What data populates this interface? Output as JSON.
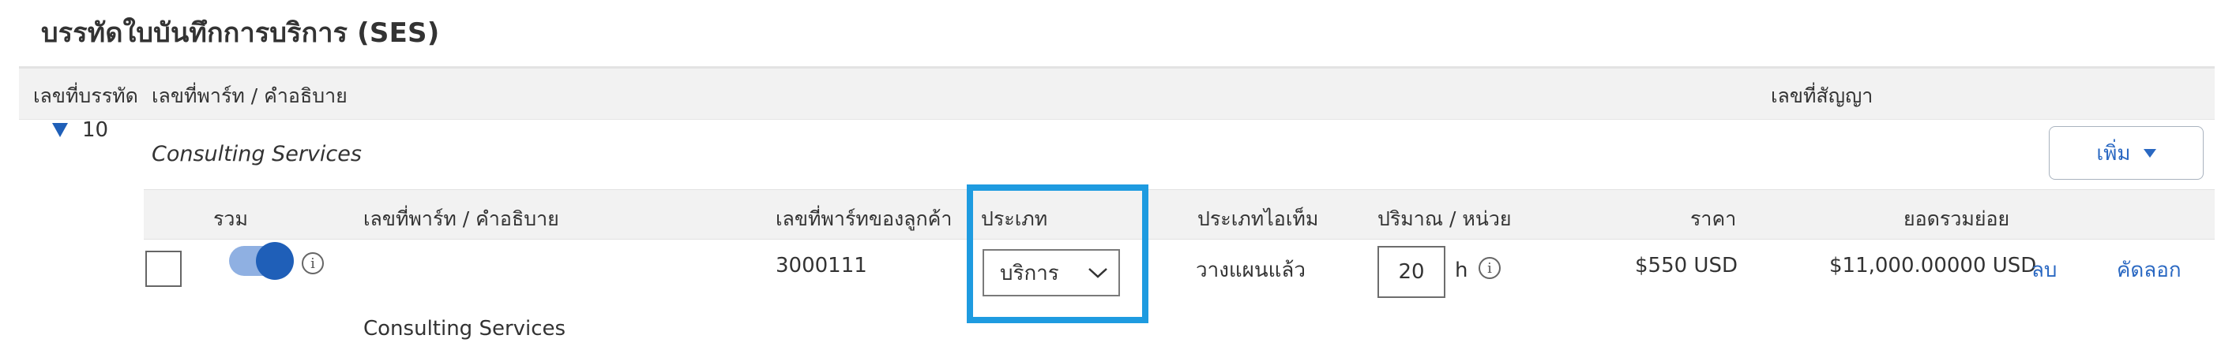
{
  "section": {
    "title": "บรรทัดใบบันทึกการบริการ (SES)"
  },
  "header": {
    "line_number": "เลขที่บรรทัด",
    "part_description": "เลขที่พาร์ท / คำอธิบาย",
    "contract_number": "เลขที่สัญญา"
  },
  "line": {
    "number": "10",
    "title": "Consulting Services",
    "add_button": "เพิ่ม"
  },
  "columns": {
    "include": "รวม",
    "part_description": "เลขที่พาร์ท / คำอธิบาย",
    "customer_part_number": "เลขที่พาร์ทของลูกค้า",
    "type": "ประเภท",
    "item_type": "ประเภทไอเท็ม",
    "quantity_unit": "ปริมาณ / หน่วย",
    "price": "ราคา",
    "subtotal": "ยอดรวมย่อย"
  },
  "row": {
    "include_toggle": true,
    "customer_part_number": "3000111",
    "type_selected": "บริการ",
    "item_type": "วางแผนแล้ว",
    "quantity": "20",
    "unit": "h",
    "price": "$550 USD",
    "subtotal": "$11,000.00000 USD",
    "delete_link": "ลบ",
    "copy_link": "คัดลอก",
    "description": "Consulting Services"
  },
  "colors": {
    "accent": "#1f5fb8",
    "link": "#2a68c2",
    "highlight": "#1e9be0"
  }
}
